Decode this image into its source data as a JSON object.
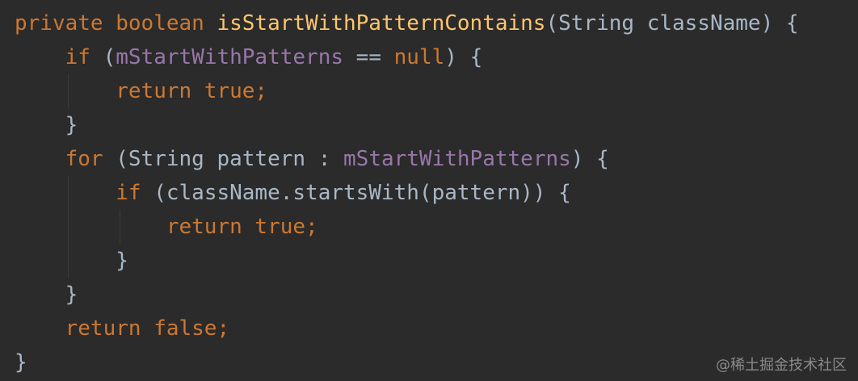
{
  "editor": {
    "theme_background": "#2b2b2b",
    "colors": {
      "keyword": "#cc7832",
      "method": "#ffc66d",
      "field": "#9876aa",
      "text": "#a9b7c6"
    },
    "lines": [
      [
        {
          "t": "private ",
          "c": "kw"
        },
        {
          "t": "boolean ",
          "c": "kw"
        },
        {
          "t": "isStartWithPatternContains",
          "c": "fn"
        },
        {
          "t": "(String className) {",
          "c": "plain"
        }
      ],
      [
        {
          "t": "    ",
          "c": "plain"
        },
        {
          "t": "if ",
          "c": "kw"
        },
        {
          "t": "(",
          "c": "plain"
        },
        {
          "t": "mStartWithPatterns",
          "c": "field"
        },
        {
          "t": " == ",
          "c": "plain"
        },
        {
          "t": "null",
          "c": "kw"
        },
        {
          "t": ") {",
          "c": "plain"
        }
      ],
      [
        {
          "t": "        ",
          "c": "plain"
        },
        {
          "t": "return true",
          "c": "kw"
        },
        {
          "t": ";",
          "c": "kw"
        }
      ],
      [
        {
          "t": "    }",
          "c": "plain"
        }
      ],
      [
        {
          "t": "    ",
          "c": "plain"
        },
        {
          "t": "for ",
          "c": "kw"
        },
        {
          "t": "(String pattern : ",
          "c": "plain"
        },
        {
          "t": "mStartWithPatterns",
          "c": "field"
        },
        {
          "t": ") {",
          "c": "plain"
        }
      ],
      [
        {
          "t": "        ",
          "c": "plain"
        },
        {
          "t": "if ",
          "c": "kw"
        },
        {
          "t": "(className.startsWith(pattern)) {",
          "c": "plain"
        }
      ],
      [
        {
          "t": "            ",
          "c": "plain"
        },
        {
          "t": "return true",
          "c": "kw"
        },
        {
          "t": ";",
          "c": "kw"
        }
      ],
      [
        {
          "t": "        }",
          "c": "plain"
        }
      ],
      [
        {
          "t": "    }",
          "c": "plain"
        }
      ],
      [
        {
          "t": "    ",
          "c": "plain"
        },
        {
          "t": "return false",
          "c": "kw"
        },
        {
          "t": ";",
          "c": "kw"
        }
      ],
      [
        {
          "t": "}",
          "c": "plain"
        }
      ]
    ]
  },
  "watermark": {
    "text": "@稀土掘金技术社区"
  }
}
